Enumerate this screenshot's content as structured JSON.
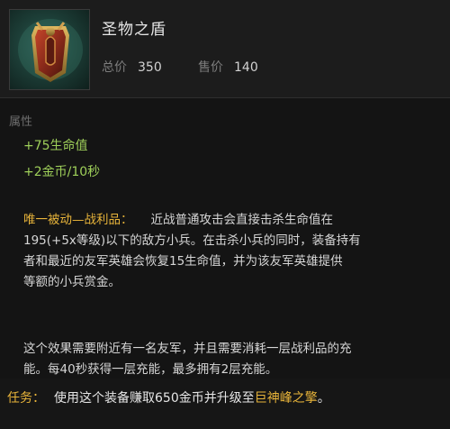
{
  "item": {
    "name": "圣物之盾",
    "icon": "relic-shield-icon",
    "total_price_label": "总价",
    "total_price": "350",
    "sell_price_label": "售价",
    "sell_price": "140"
  },
  "attributes": {
    "label": "属性",
    "stats": [
      "+75生命值",
      "+2金币/10秒"
    ]
  },
  "passive": {
    "title": "唯一被动—战利品：",
    "line1": "近战普通攻击会直接击杀生命值在",
    "line2": "195(+5x等级)以下的敌方小兵。在击杀小兵的同时，装备持有",
    "line3": "者和最近的友军英雄会恢复15生命值，并为该友军英雄提供",
    "line4": "等额的小兵赏金。",
    "line5": "这个效果需要附近有一名友军，并且需要消耗一层战利品的充",
    "line6": "能。每40秒获得一层充能，最多拥有2层充能。"
  },
  "quest": {
    "label": "任务：",
    "text": "使用这个装备赚取650金币并升级至",
    "target": "巨神峰之擎",
    "end": "。"
  },
  "colors": {
    "stat_green": "#9fd05a",
    "gold_accent": "#e8b43a",
    "background": "#141414"
  }
}
